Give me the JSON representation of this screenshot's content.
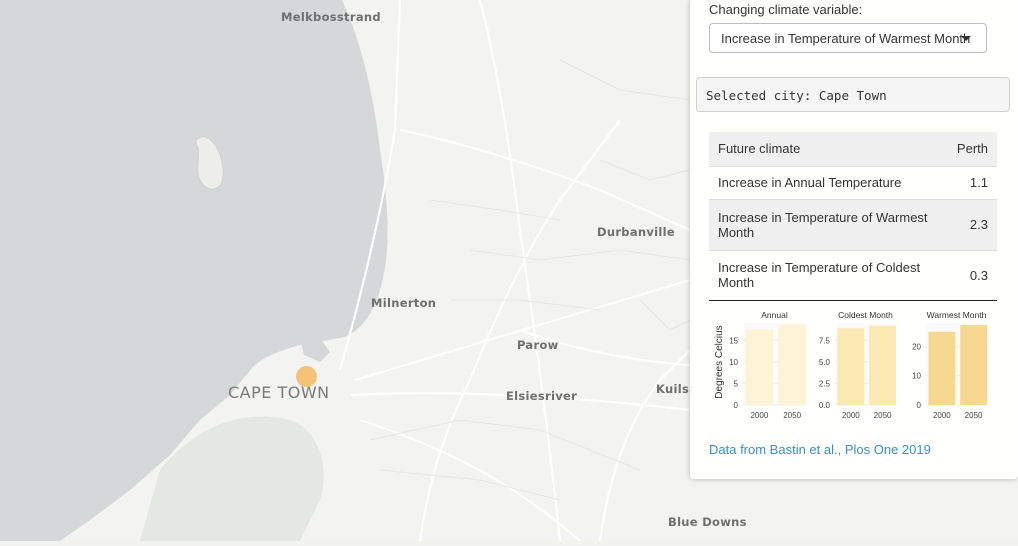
{
  "map": {
    "labels": {
      "melkbosstrand": "Melkbosstrand",
      "durbanville": "Durbanville",
      "milnerton": "Milnerton",
      "parow": "Parow",
      "cape_town": "CAPE TOWN",
      "elsiesriver": "Elsiesriver",
      "kuils": "Kuilsr",
      "blue_downs": "Blue Downs"
    }
  },
  "panel": {
    "variable_label": "Changing climate variable:",
    "select_value": "Increase in Temperature of Warmest Month",
    "selected_city_text": "Selected city: Cape Town",
    "table": {
      "headers": [
        "Future climate",
        "Perth"
      ],
      "rows": [
        [
          "Increase in Annual Temperature",
          "1.1"
        ],
        [
          "Increase in Temperature of Warmest Month",
          "2.3"
        ],
        [
          "Increase in Temperature of Coldest Month",
          "0.3"
        ]
      ]
    },
    "source_link": "Data from Bastin et al., Plos One 2019"
  },
  "chart_data": {
    "type": "bar",
    "ylabel": "Degrees Celcius",
    "categories": [
      "2000",
      "2050"
    ],
    "panels": [
      {
        "title": "Annual",
        "values": [
          17.5,
          18.6
        ],
        "ylim": [
          0,
          19
        ],
        "yticks": [
          0,
          5,
          10,
          15
        ],
        "ytick_labels": [
          "0",
          "5",
          "10",
          "15"
        ],
        "color": "#fdf4d6"
      },
      {
        "title": "Coldest Month",
        "values": [
          8.9,
          9.2
        ],
        "ylim": [
          0,
          9.5
        ],
        "yticks": [
          0,
          2.5,
          5,
          7.5
        ],
        "ytick_labels": [
          "0.0",
          "2.5",
          "5.0",
          "7.5"
        ],
        "color": "#fbe9b4"
      },
      {
        "title": "Warmest Month",
        "values": [
          25,
          27.3
        ],
        "ylim": [
          0,
          28
        ],
        "yticks": [
          0,
          10,
          20
        ],
        "ytick_labels": [
          "0",
          "10",
          "20"
        ],
        "color": "#f6d890"
      }
    ]
  }
}
